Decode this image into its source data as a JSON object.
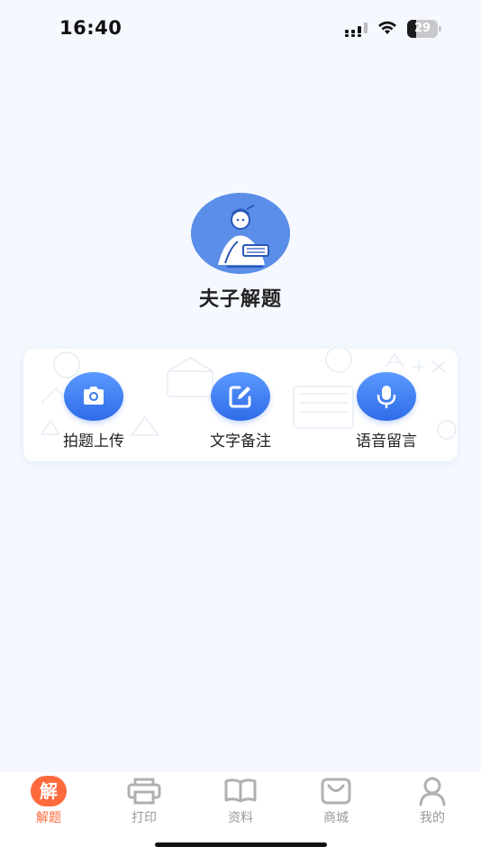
{
  "status_bar": {
    "time": "16:40",
    "battery_level": "29",
    "icons": [
      "signal-icon",
      "wifi-icon",
      "battery-icon"
    ]
  },
  "app": {
    "title": "夫子解题",
    "logo_icon": "scholar-reading-logo"
  },
  "actions": [
    {
      "label": "拍题上传",
      "icon": "camera-icon"
    },
    {
      "label": "文字备注",
      "icon": "edit-icon"
    },
    {
      "label": "语音留言",
      "icon": "microphone-icon"
    }
  ],
  "tabbar": {
    "tabs": [
      {
        "label": "解题",
        "icon": "solve-icon",
        "badge": "解",
        "active": true
      },
      {
        "label": "打印",
        "icon": "printer-icon",
        "active": false
      },
      {
        "label": "资料",
        "icon": "book-icon",
        "active": false
      },
      {
        "label": "商城",
        "icon": "shopping-bag-icon",
        "active": false
      },
      {
        "label": "我的",
        "icon": "user-icon",
        "active": false
      }
    ]
  },
  "colors": {
    "accent": "#2e6de8",
    "active_tab": "#ff6a3d",
    "background": "#f5f9ff"
  }
}
